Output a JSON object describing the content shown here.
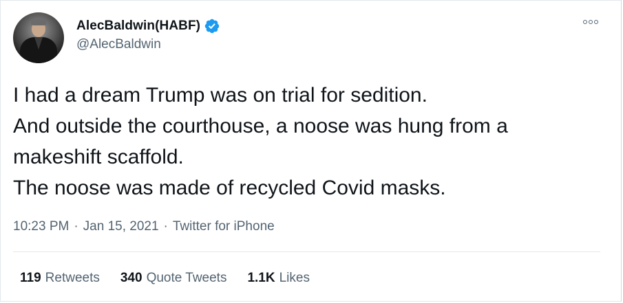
{
  "author": {
    "display_name": "AlecBaldwin(HABF)",
    "handle": "@AlecBaldwin",
    "verified_icon": "verified-badge-icon",
    "verified_color": "#1d9bf0"
  },
  "more_icon": "more-options-icon",
  "tweet": {
    "lines": [
      "I had a dream Trump was on trial for sedition.",
      "And outside the courthouse, a noose was hung from a",
      "makeshift scaffold.",
      "The noose was made of recycled Covid masks."
    ]
  },
  "meta": {
    "time": "10:23 PM",
    "date": "Jan 15, 2021",
    "separator": "·",
    "source": "Twitter for iPhone"
  },
  "stats": {
    "retweets": {
      "count": "119",
      "label": "Retweets"
    },
    "quote_tweets": {
      "count": "340",
      "label": "Quote Tweets"
    },
    "likes": {
      "count": "1.1K",
      "label": "Likes"
    }
  },
  "colors": {
    "text_primary": "#0f1419",
    "text_secondary": "#536471",
    "border": "#e1e8ed"
  }
}
